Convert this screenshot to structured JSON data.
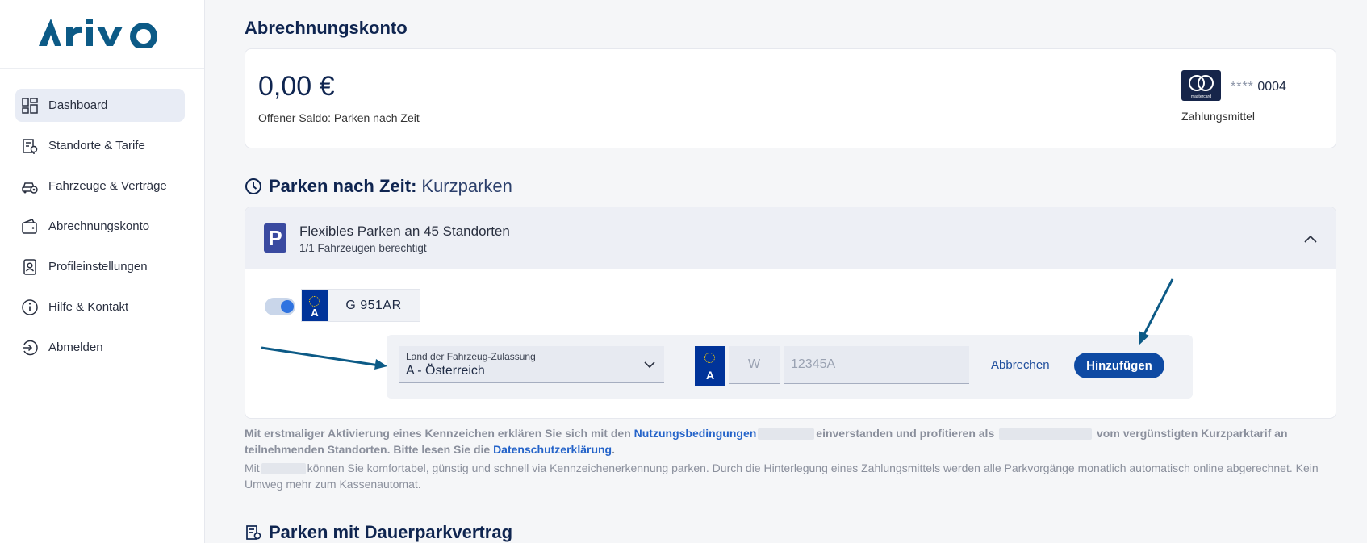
{
  "brand": {
    "logo_text": "Arivo"
  },
  "sidebar": {
    "items": [
      {
        "label": "Dashboard",
        "icon": "dashboard-icon",
        "active": true
      },
      {
        "label": "Standorte & Tarife",
        "icon": "locations-tariffs-icon"
      },
      {
        "label": "Fahrzeuge & Verträge",
        "icon": "vehicle-settings-icon"
      },
      {
        "label": "Abrechnungskonto",
        "icon": "wallet-icon"
      },
      {
        "label": "Profileinstellungen",
        "icon": "profile-icon"
      },
      {
        "label": "Hilfe & Kontakt",
        "icon": "info-icon"
      },
      {
        "label": "Abmelden",
        "icon": "logout-icon"
      }
    ]
  },
  "account": {
    "title": "Abrechnungskonto",
    "amount": "0,00 €",
    "balance_label": "Offener Saldo: Parken nach Zeit",
    "card_mask": "****",
    "card_last4": "0004",
    "card_brand": "mastercard",
    "payment_label": "Zahlungsmittel"
  },
  "parking": {
    "title_strong": "Parken nach Zeit:",
    "title_light": "Kurzparken",
    "badge": "P",
    "product_name": "Flexibles Parken an 45 Standorten",
    "product_sub": "1/1 Fahrzeugen berechtigt",
    "vehicle": {
      "enabled": true,
      "country_code": "A",
      "plate": "G 951AR"
    },
    "form": {
      "country_label": "Land der Fahrzeug-Zulassung",
      "country_value": "A - Österreich",
      "country_code": "A",
      "area_placeholder": "W",
      "number_placeholder": "12345A",
      "cancel_label": "Abbrechen",
      "add_label": "Hinzufügen"
    }
  },
  "legal": {
    "p1_a": "Mit erstmaliger Aktivierung eines Kennzeichen erklären Sie sich mit den ",
    "p1_link1": "Nutzungsbedingungen",
    "p1_b": "einverstanden und profitieren als",
    "p1_c": "vom vergünstigten Kurzparktarif an teilnehmenden Standorten. Bitte lesen Sie die ",
    "p1_link2": "Datenschutzerklärung",
    "p1_d": ".",
    "p2_a": "Mit",
    "p2_b": "können Sie komfortabel, günstig und schnell via Kennzeichenerkennung parken. Durch die Hinterlegung eines Zahlungsmittels werden alle Parkvorgänge monatlich automatisch online abgerechnet. Kein Umweg mehr zum Kassenautomat."
  },
  "section2": {
    "title": "Parken mit Dauerparkvertrag"
  },
  "colors": {
    "primary": "#0e4aa3",
    "brand": "#0c5a86",
    "arrow": "#0c5a86",
    "link": "#2463c9"
  }
}
